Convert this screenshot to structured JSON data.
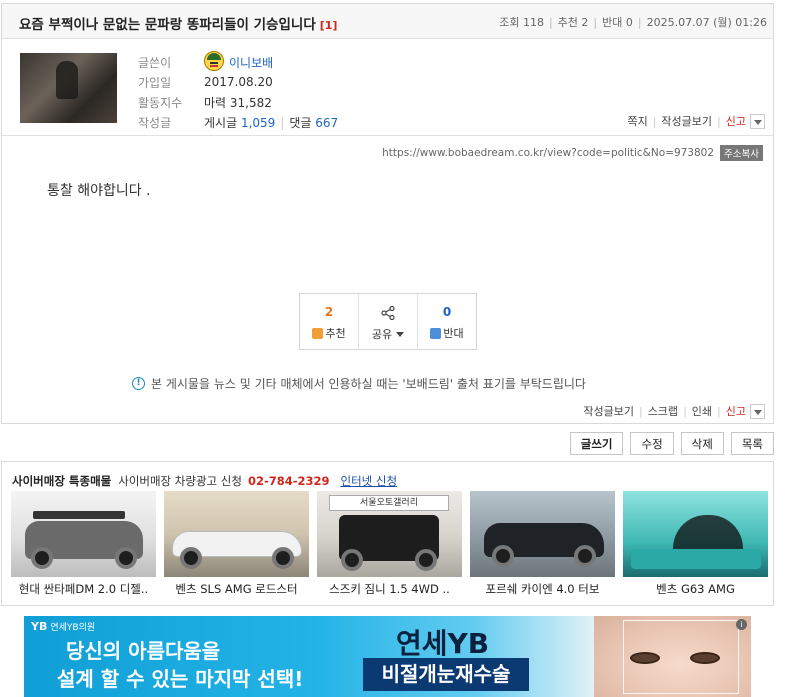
{
  "post": {
    "title": "요즘 부쩍이나 문없는 문파랑 똥파리들이 기승입니다",
    "comment_count": "[1]",
    "views_label": "조회",
    "views": "118",
    "recommend_label": "추천",
    "recommend": "2",
    "oppose_label": "반대",
    "oppose": "0",
    "date": "2025.07.07 (월) 01:26",
    "body": "통찰 해야합니다 ."
  },
  "author": {
    "writer_label": "글쓴이",
    "nickname": "이니보배",
    "joined_label": "가입일",
    "joined": "2017.08.20",
    "activity_label": "활동지수",
    "activity": "마력 31,582",
    "posts_label": "작성글",
    "posts_prefix": "게시글",
    "posts_count": "1,059",
    "comments_prefix": "댓글",
    "comments_count": "667",
    "links": [
      "쪽지",
      "작성글보기",
      "신고"
    ]
  },
  "url": {
    "text": "https://www.bobaedream.co.kr/view?code=politic&No=973802",
    "copy_label": "주소복사"
  },
  "votes": {
    "up_count": "2",
    "up_label": "추천",
    "share_label": "공유",
    "down_count": "0",
    "down_label": "반대"
  },
  "notice": "본 게시물을 뉴스 및 기타 매체에서 인용하실 때는 '보배드림' 출처 표기를 부탁드립니다",
  "bottom_links": [
    "작성글보기",
    "스크랩",
    "인쇄",
    "신고"
  ],
  "buttons": [
    "글쓰기",
    "수정",
    "삭제",
    "목록"
  ],
  "ad": {
    "title": "사이버매장 특종매물",
    "subtitle": "사이버매장 차량광고 신청",
    "phone": "02-784-2329",
    "internet": "인터넷 신청",
    "sign_text": "서울오토갤러리",
    "cars": [
      {
        "name": "현대 싼타페DM 2.0 디젤.."
      },
      {
        "name": "벤츠 SLS AMG 로드스터"
      },
      {
        "name": "스즈키 짐니 1.5 4WD .."
      },
      {
        "name": "포르쉐 카이엔 4.0 터보"
      },
      {
        "name": "벤츠 G63 AMG"
      }
    ]
  },
  "banner": {
    "logo": "연세YB의원",
    "line1": "당신의 아름다움을",
    "line2": "설계 할 수 있는 마지막 선택!",
    "brand": "연세YB",
    "cta": "비절개눈재수술"
  }
}
